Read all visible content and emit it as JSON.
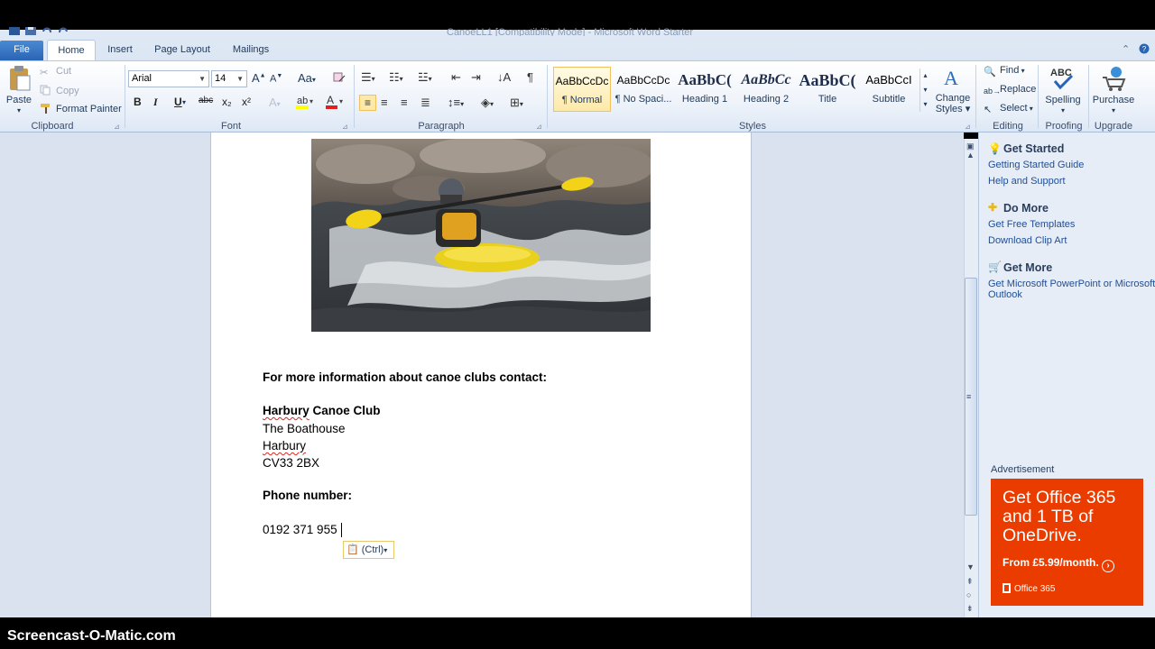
{
  "window": {
    "title": "CanoeLL1 [Compatibility Mode] - Microsoft Word Starter"
  },
  "tabs": {
    "file": "File",
    "home": "Home",
    "insert": "Insert",
    "page_layout": "Page Layout",
    "mailings": "Mailings"
  },
  "clipboard": {
    "paste": "Paste",
    "cut": "Cut",
    "copy": "Copy",
    "format_painter": "Format Painter",
    "group": "Clipboard"
  },
  "font": {
    "name": "Arial",
    "size": "14",
    "group": "Font",
    "bold": "B",
    "italic": "I",
    "underline": "U",
    "strike": "abc",
    "sub": "x₂",
    "sup": "x²"
  },
  "paragraph": {
    "group": "Paragraph"
  },
  "styles": {
    "group": "Styles",
    "items": [
      {
        "sample": "AaBbCcDc",
        "name": "¶ Normal"
      },
      {
        "sample": "AaBbCcDc",
        "name": "¶ No Spaci..."
      },
      {
        "sample": "AaBbC(",
        "name": "Heading 1"
      },
      {
        "sample": "AaBbCc",
        "name": "Heading 2"
      },
      {
        "sample": "AaBbC(",
        "name": "Title"
      },
      {
        "sample": "AaBbCcI",
        "name": "Subtitle"
      }
    ],
    "change_styles_1": "Change",
    "change_styles_2": "Styles ▾"
  },
  "editing": {
    "group": "Editing",
    "find": "Find",
    "replace": "Replace",
    "select": "Select"
  },
  "proofing": {
    "group": "Proofing",
    "spelling": "Spelling"
  },
  "upgrade": {
    "group": "Upgrade",
    "purchase": "Purchase"
  },
  "document": {
    "heading": "For more information about canoe clubs contact:",
    "club_name_1": "Harbury",
    "club_name_2": " Canoe Club",
    "address_1": "The Boathouse",
    "address_2": "Harbury",
    "address_3": "CV33 2BX",
    "phone_label": "Phone number:",
    "phone": "0192 371 955",
    "paste_options": "(Ctrl)"
  },
  "pane": {
    "started": {
      "title": "Get Started",
      "links": [
        "Getting Started Guide",
        "Help and Support"
      ]
    },
    "do_more": {
      "title": "Do More",
      "links": [
        "Get Free Templates",
        "Download Clip Art"
      ]
    },
    "get_more": {
      "title": "Get More",
      "link_1": "Get Microsoft PowerPoint or Microsoft",
      "link_2": "Outlook"
    },
    "advertisement": "Advertisement",
    "ad": {
      "headline": "Get Office 365 and 1 TB of OneDrive.",
      "price": "From £5.99/month.",
      "brand": "Office 365"
    }
  },
  "watermark": "Screencast-O-Matic.com",
  "colors": {
    "file_tab": "#2a64b4",
    "ad_bg": "#eb3c00",
    "link": "#1f4e96",
    "style_selected": "#fde9a8"
  }
}
